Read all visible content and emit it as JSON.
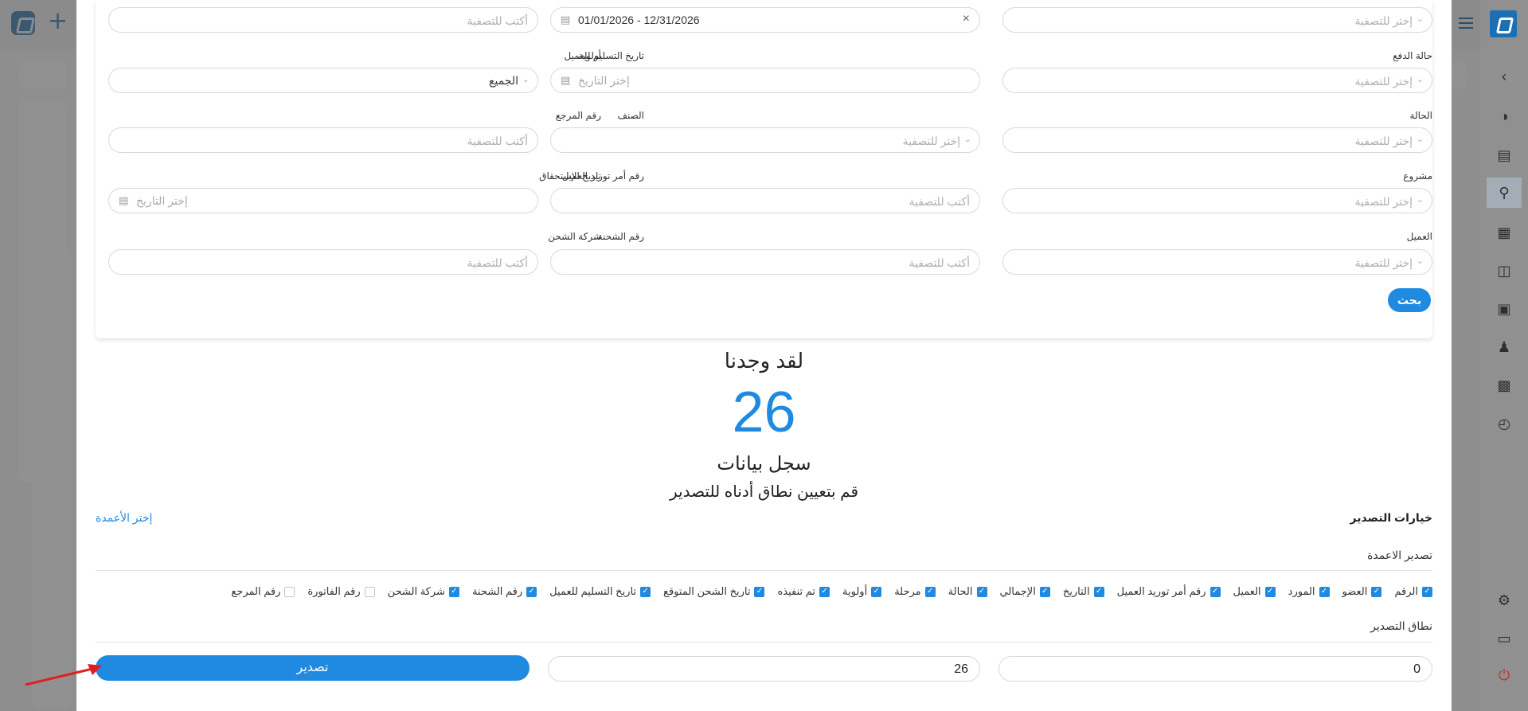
{
  "filters": {
    "row0": {
      "right_placeholder": "إختر للتصفية",
      "date_range": "01/01/2026 - 12/31/2026",
      "left_placeholder": "أكتب للتصفية"
    },
    "payment_status": {
      "label": "حالة الدفع",
      "placeholder": "إختر للتصفية"
    },
    "delivery_date": {
      "label": "تاريخ التسليم للعميل",
      "placeholder": "إختر التاريخ"
    },
    "priority": {
      "label": "أولوية",
      "value": "الجميع"
    },
    "status": {
      "label": "الحالة",
      "placeholder": "إختر للتصفية"
    },
    "category": {
      "label": "الصنف",
      "placeholder": "إختر للتصفية"
    },
    "reference_no": {
      "label": "رقم المرجع",
      "placeholder": "أكتب للتصفية"
    },
    "project": {
      "label": "مشروع",
      "placeholder": "إختر للتصفية"
    },
    "customer_po": {
      "label": "رقم أمر توريد العميل",
      "placeholder": "أكتب للتصفية"
    },
    "due_date": {
      "label": "تاريخ الإستحقاق",
      "placeholder": "إختر التاريخ"
    },
    "customer": {
      "label": "العميل",
      "placeholder": "إختر للتصفية"
    },
    "shipment_no": {
      "label": "رقم الشحنة",
      "placeholder": "أكتب للتصفية"
    },
    "shipping_company": {
      "label": "شركة الشحن",
      "placeholder": "أكتب للتصفية"
    },
    "search_button": "بحث"
  },
  "results": {
    "title": "لقد وجدنا",
    "count": "26",
    "subtitle": "سجل بيانات",
    "hint": "قم بتعيين نطاق أدناه للتصدير"
  },
  "export": {
    "options_title": "خيارات التصدير",
    "choose_columns": "إختر الأعمدة",
    "export_columns_label": "تصدير الاعمدة",
    "columns": [
      {
        "label": "الرقم",
        "checked": true
      },
      {
        "label": "العضو",
        "checked": true
      },
      {
        "label": "المورد",
        "checked": true
      },
      {
        "label": "العميل",
        "checked": true
      },
      {
        "label": "رقم أمر توريد العميل",
        "checked": true
      },
      {
        "label": "التاريخ",
        "checked": true
      },
      {
        "label": "الإجمالي",
        "checked": true
      },
      {
        "label": "الحالة",
        "checked": true
      },
      {
        "label": "مرحلة",
        "checked": true
      },
      {
        "label": "أولوية",
        "checked": true
      },
      {
        "label": "تم تنفيذه",
        "checked": true
      },
      {
        "label": "تاريخ الشحن المتوقع",
        "checked": true
      },
      {
        "label": "تاريخ التسليم للعميل",
        "checked": true
      },
      {
        "label": "رقم الشحنة",
        "checked": true
      },
      {
        "label": "شركة الشحن",
        "checked": true
      },
      {
        "label": "رقم الفاتورة",
        "checked": false
      },
      {
        "label": "رقم المرجع",
        "checked": false
      }
    ],
    "range_label": "نطاق التصدير",
    "range_from": "0",
    "range_to": "26",
    "export_button": "تصدير"
  },
  "colors": {
    "accent": "#1f8ae0",
    "arrow": "#e02020"
  }
}
